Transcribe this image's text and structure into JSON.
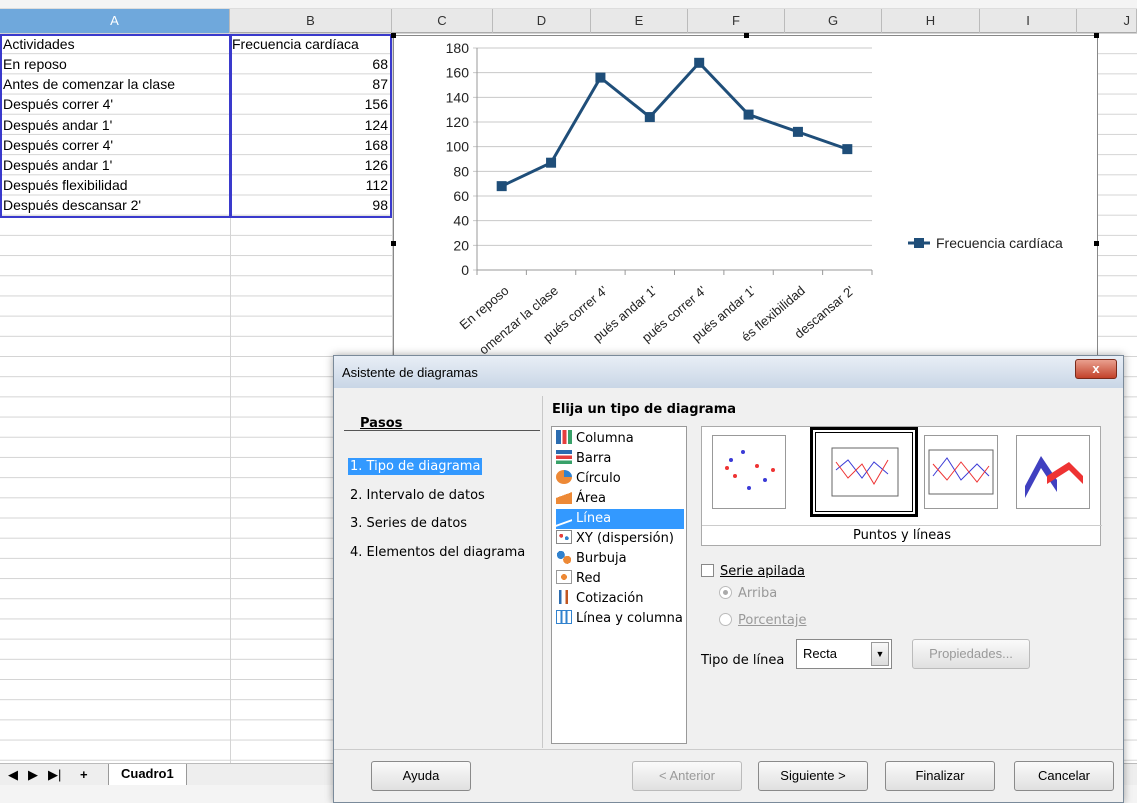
{
  "spreadsheet": {
    "columns": [
      "A",
      "B",
      "C",
      "D",
      "E",
      "F",
      "G",
      "H",
      "I",
      "J"
    ],
    "header": {
      "activity": "Actividades",
      "heart_rate": "Frecuencia cardíaca"
    },
    "rows": [
      {
        "activity": "En reposo",
        "value": "68"
      },
      {
        "activity": "Antes de comenzar la clase",
        "value": "87"
      },
      {
        "activity": "Después correr 4'",
        "value": "156"
      },
      {
        "activity": "Después andar 1'",
        "value": "124"
      },
      {
        "activity": "Después correr 4'",
        "value": "168"
      },
      {
        "activity": "Después andar 1'",
        "value": "126"
      },
      {
        "activity": "Después flexibilidad",
        "value": "112"
      },
      {
        "activity": "Después descansar 2'",
        "value": "98"
      }
    ],
    "sheet_tab": "Cuadro1",
    "nav": {
      "first": "◀",
      "prev": "▶",
      "last": "▶|",
      "add": "+"
    }
  },
  "chart_data": {
    "type": "line",
    "categories": [
      "En reposo",
      "Antes de comenzar la clase",
      "Después correr 4'",
      "Después andar 1'",
      "Después correr 4'",
      "Después andar 1'",
      "Después flexibilidad",
      "Después descansar 2'"
    ],
    "x_tick_labels": [
      "En reposo",
      "omenzar la clase",
      "pués correr 4'",
      "pués andar 1'",
      "pués correr 4'",
      "pués andar 1'",
      "és flexibilidad",
      "descansar 2'"
    ],
    "series": [
      {
        "name": "Frecuencia cardíaca",
        "values": [
          68,
          87,
          156,
          124,
          168,
          126,
          112,
          98
        ]
      }
    ],
    "ylim": [
      0,
      180
    ],
    "yticks": [
      "0",
      "20",
      "40",
      "60",
      "80",
      "100",
      "120",
      "140",
      "160",
      "180"
    ],
    "grid": true,
    "legend": "right",
    "color": "#1f4e79"
  },
  "dialog": {
    "title": "Asistente de diagramas",
    "close": "x",
    "steps_heading": "Pasos",
    "steps": [
      "1. Tipo de diagrama",
      "2. Intervalo de datos",
      "3. Series de datos",
      "4. Elementos del diagrama"
    ],
    "type_heading": "Elija un tipo de diagrama",
    "chart_types": [
      "Columna",
      "Barra",
      "Círculo",
      "Área",
      "Línea",
      "XY (dispersión)",
      "Burbuja",
      "Red",
      "Cotización",
      "Línea y columna"
    ],
    "selected_type": "Línea",
    "variant_label": "Puntos y líneas",
    "stacked": "Serie apilada",
    "radio_top": "Arriba",
    "radio_percent": "Porcentaje",
    "line_type_label": "Tipo de línea",
    "line_type_value": "Recta",
    "properties": "Propiedades...",
    "buttons": {
      "help": "Ayuda",
      "back": "< Anterior",
      "next": "Siguiente >",
      "finish": "Finalizar",
      "cancel": "Cancelar"
    }
  }
}
